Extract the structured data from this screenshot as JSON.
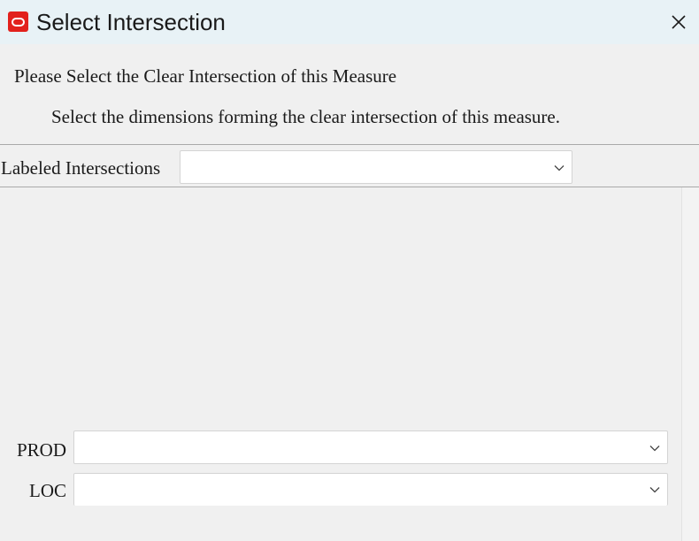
{
  "window": {
    "title": "Select Intersection",
    "app_icon": "oracle-logo-icon",
    "close_icon": "close-icon"
  },
  "content": {
    "heading": "Please Select the Clear Intersection of this Measure",
    "subheading": "Select the dimensions forming the clear intersection of this measure."
  },
  "labeled_intersections": {
    "label": "Labeled Intersections",
    "value": ""
  },
  "dimensions": [
    {
      "label": "PROD",
      "value": ""
    },
    {
      "label": "LOC",
      "value": ""
    }
  ],
  "colors": {
    "titlebar_bg": "#e8f2f6",
    "window_bg": "#f0f0f0",
    "brand_red": "#e2211c"
  }
}
